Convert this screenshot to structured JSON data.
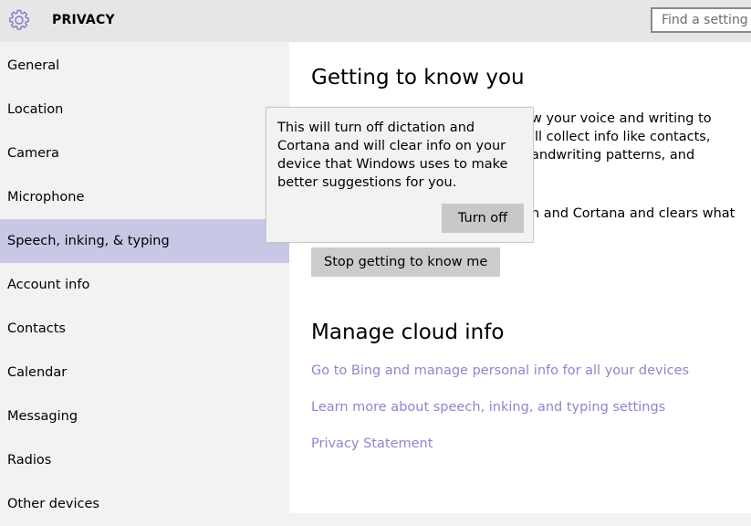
{
  "header": {
    "icon": "gear-icon",
    "title": "PRIVACY",
    "search_placeholder": "Find a setting"
  },
  "sidebar": {
    "selected_index": 4,
    "items": [
      {
        "label": "General"
      },
      {
        "label": "Location"
      },
      {
        "label": "Camera"
      },
      {
        "label": "Microphone"
      },
      {
        "label": "Speech, inking, & typing"
      },
      {
        "label": "Account info"
      },
      {
        "label": "Contacts"
      },
      {
        "label": "Calendar"
      },
      {
        "label": "Messaging"
      },
      {
        "label": "Radios"
      },
      {
        "label": "Other devices"
      }
    ]
  },
  "main": {
    "section1_heading": "Getting to know you",
    "visible_line1": "w your voice and writing to",
    "visible_line2": "'ll collect info like contacts,",
    "visible_line3": "andwriting patterns, and",
    "visible_line4": "n and Cortana and clears what",
    "stop_button": "Stop getting to know me",
    "section2_heading": "Manage cloud info",
    "links": [
      "Go to Bing and manage personal info for all your devices",
      "Learn more about speech, inking, and typing settings",
      "Privacy Statement"
    ]
  },
  "popup": {
    "message": "This will turn off dictation and Cortana and will clear info on your device that Windows uses to make better suggestions for you.",
    "button": "Turn off"
  },
  "colors": {
    "header_bg": "#e6e6e6",
    "sidebar_bg": "#f2f2f2",
    "selected_bg": "#c8c7e6",
    "link": "#8e86cc",
    "accent_icon": "#7f77c9",
    "button_bg": "#cccccc"
  }
}
